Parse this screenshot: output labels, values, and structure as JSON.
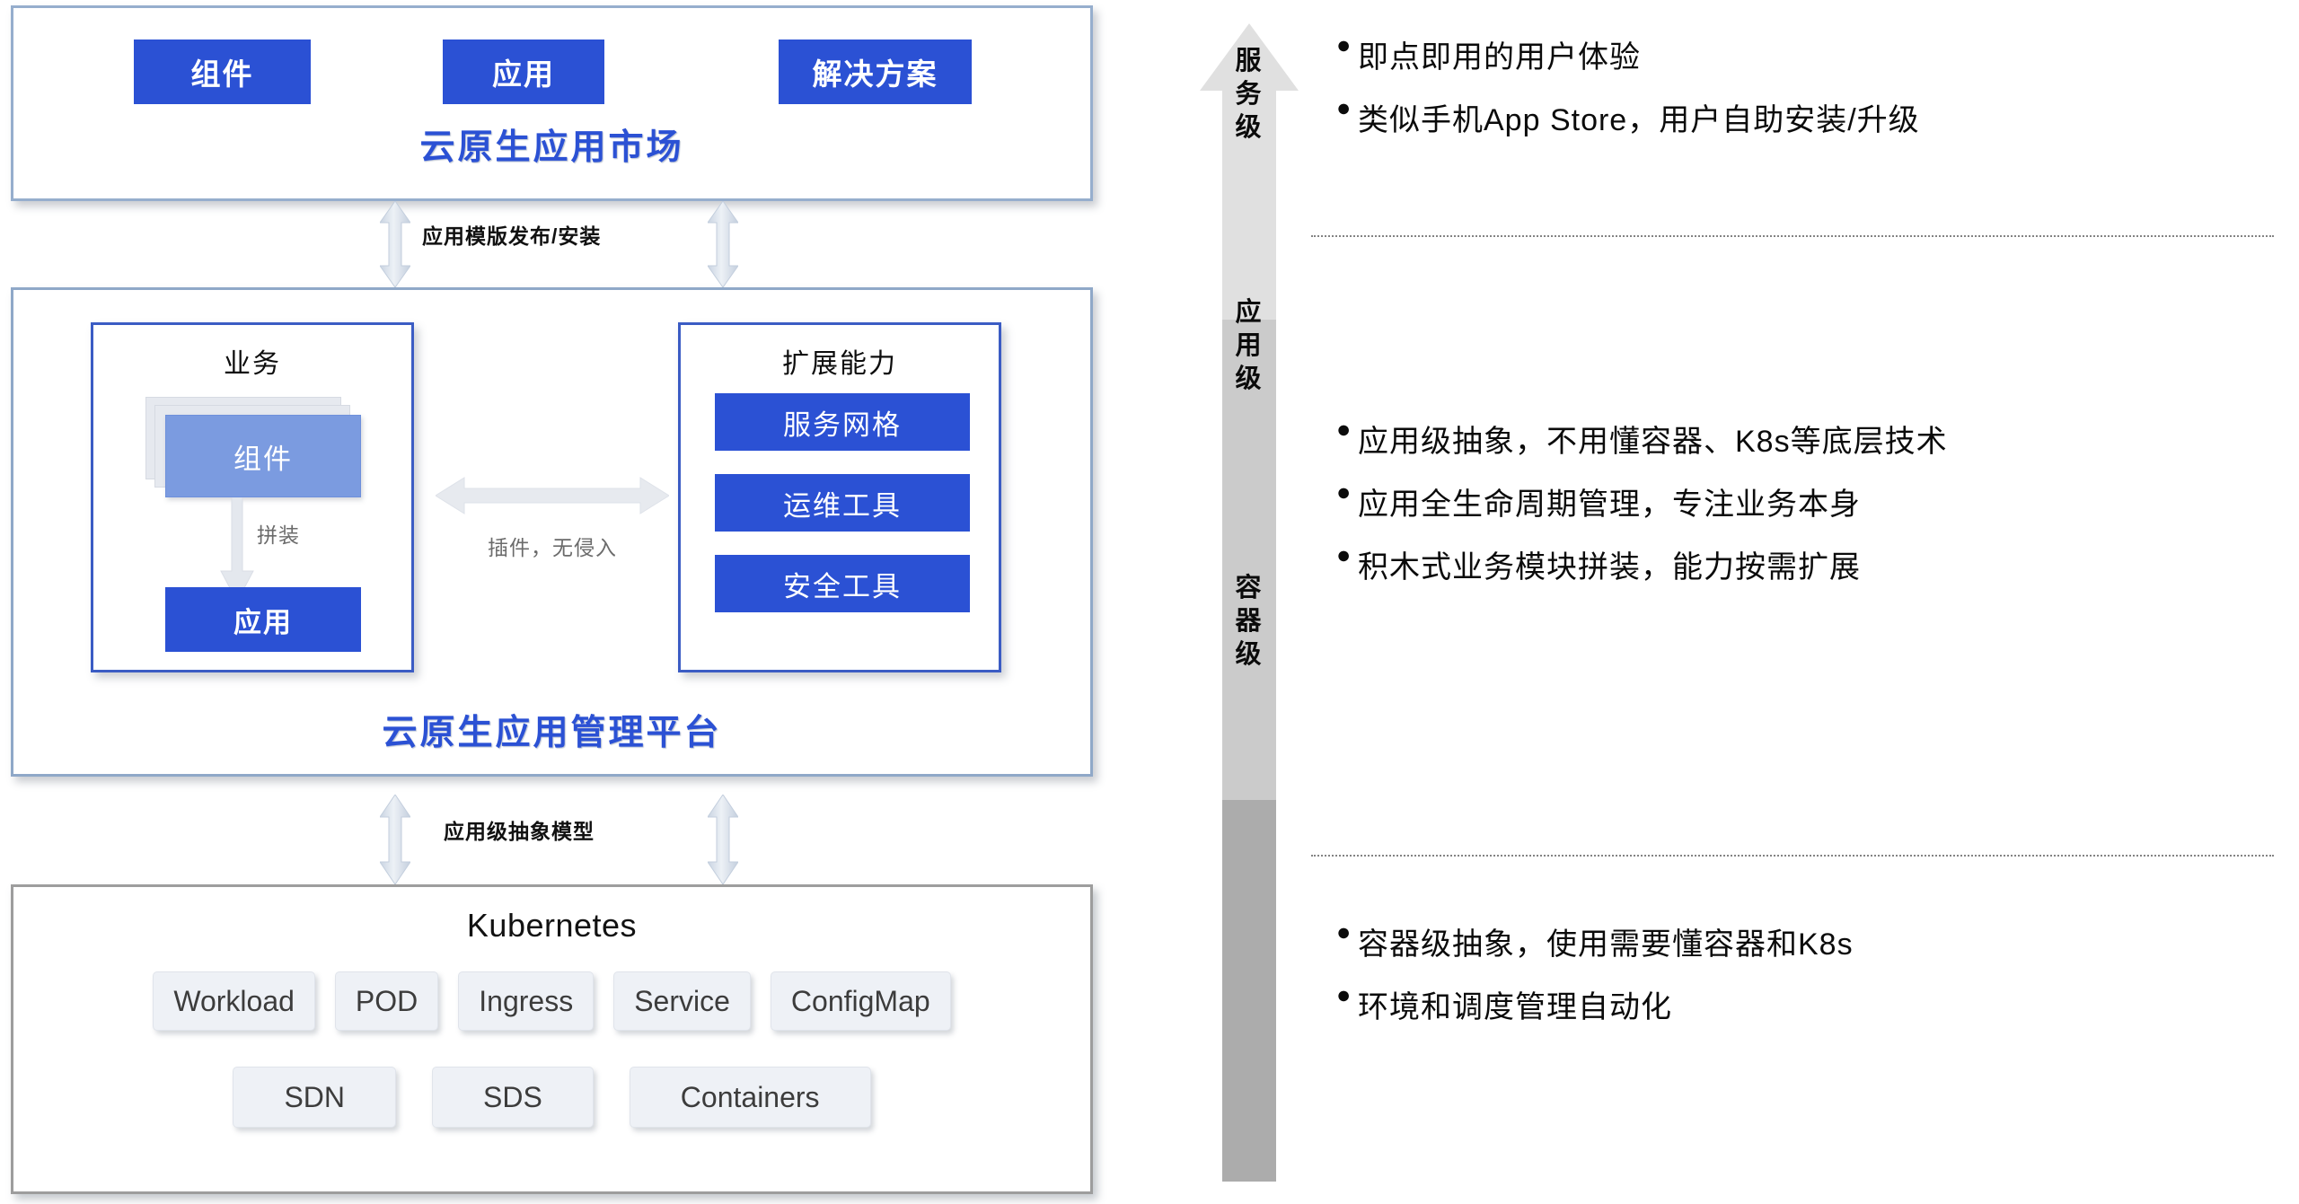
{
  "diagram": {
    "title_alt": "云原生应用平台分层架构",
    "colors": {
      "brand_blue": "#2B51D4",
      "component_blue": "#7B9BE0",
      "panel_border_blue": "#96AECD",
      "inner_border_blue": "#3B5CC4",
      "k8s_border_gray": "#9D9D9D",
      "tile_gray": "#EEF1F6",
      "arrow_light": "#E2E2E2",
      "arrow_mid": "#CBCBCB",
      "arrow_dark": "#ADADAD"
    }
  },
  "marketplace": {
    "title": "云原生应用市场",
    "chips": [
      "组件",
      "应用",
      "解决方案"
    ]
  },
  "connector_top": {
    "label": "应用模版发布/安装",
    "icon": "double-headed-vertical-arrow"
  },
  "platform": {
    "title": "云原生应用管理平台",
    "business": {
      "title": "业务",
      "component_card": "组件",
      "assemble_label": "拼装",
      "app_card": "应用",
      "assemble_icon": "down-arrow"
    },
    "extension": {
      "title": "扩展能力",
      "items": [
        "服务网格",
        "运维工具",
        "安全工具"
      ]
    },
    "link": {
      "label": "插件，无侵入",
      "icon": "double-headed-horizontal-arrow"
    }
  },
  "connector_bottom": {
    "label": "应用级抽象模型",
    "icon": "double-headed-vertical-arrow"
  },
  "kubernetes": {
    "title": "Kubernetes",
    "row1": [
      "Workload",
      "POD",
      "Ingress",
      "Service",
      "ConfigMap"
    ],
    "row2": [
      "SDN",
      "SDS",
      "Containers"
    ]
  },
  "levels": {
    "arrow_icon": "up-arrow-stack",
    "items": [
      {
        "label": "服务级",
        "bullets": [
          "即点即用的用户体验",
          "类似手机App Store，用户自助安装/升级"
        ]
      },
      {
        "label": "应用级",
        "bullets": [
          "应用级抽象，不用懂容器、K8s等底层技术",
          "应用全生命周期管理，专注业务本身",
          "积木式业务模块拼装，能力按需扩展"
        ]
      },
      {
        "label": "容器级",
        "bullets": [
          "容器级抽象，使用需要懂容器和K8s",
          "环境和调度管理自动化"
        ]
      }
    ]
  }
}
